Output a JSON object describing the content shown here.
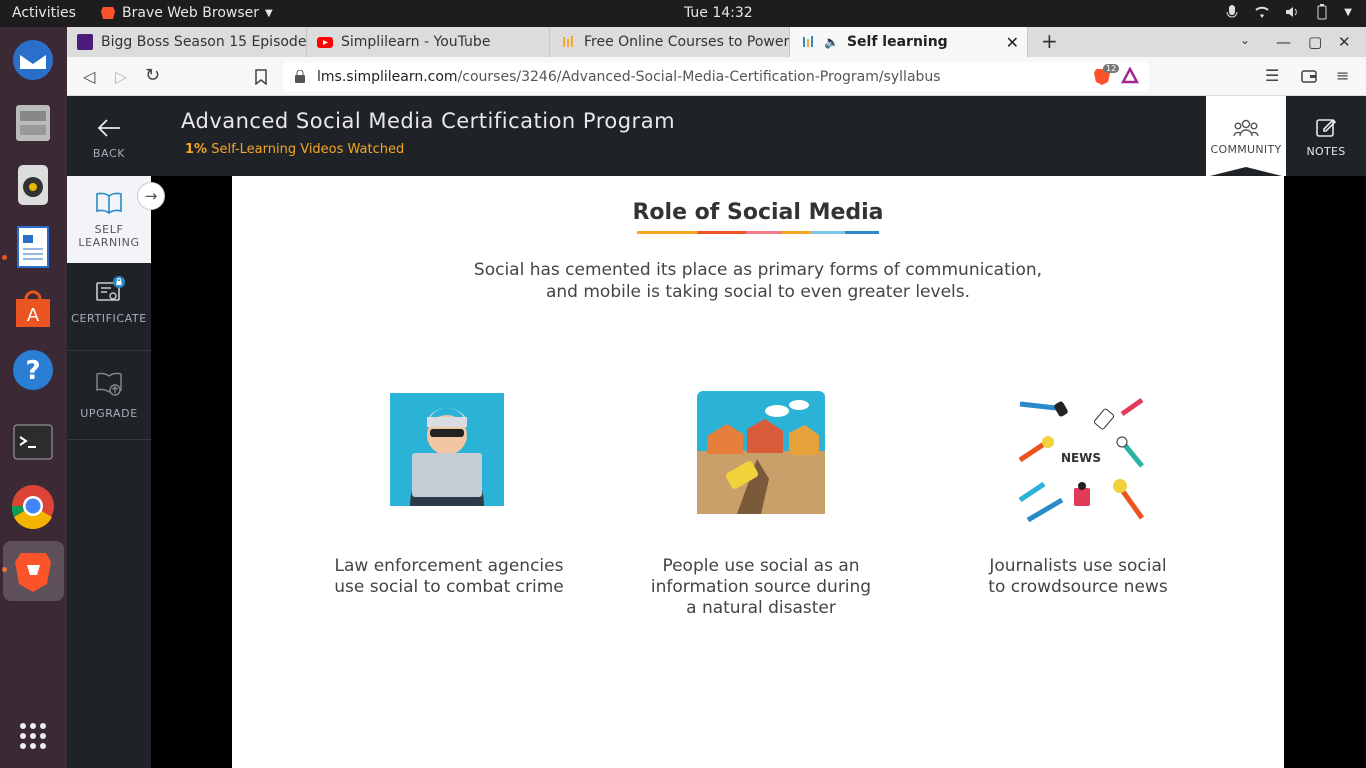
{
  "topbar": {
    "activities": "Activities",
    "app_name": "Brave Web Browser",
    "clock": "Tue 14:32"
  },
  "dock": {
    "apps": [
      "Thunderbird Mail",
      "Files",
      "Rhythmbox",
      "LibreOffice Writer",
      "Ubuntu Software",
      "Help",
      "Terminal",
      "Google Chrome",
      "Brave Web Browser",
      "Show Applications"
    ]
  },
  "browser": {
    "tabs": [
      {
        "label": "Bigg Boss Season 15 Episode",
        "favicon": "voot-icon"
      },
      {
        "label": "Simplilearn - YouTube",
        "favicon": "youtube-icon"
      },
      {
        "label": "Free Online Courses to Power",
        "favicon": "simplilearn-icon"
      },
      {
        "label": "Self learning",
        "favicon": "simplilearn-icon"
      }
    ],
    "url_host": "lms.simplilearn.com",
    "url_path": "/courses/3246/Advanced-Social-Media-Certification-Program/syllabus",
    "shield_count": "12"
  },
  "header": {
    "title": "Advanced Social Media Certification Program",
    "progress_value": "1%",
    "progress_label": "Self-Learning Videos Watched",
    "community_label": "COMMUNITY",
    "notes_label": "NOTES"
  },
  "sidebar": {
    "back_label": "BACK",
    "self_label_1": "SELF",
    "self_label_2": "LEARNING",
    "certificate_label": "CERTIFICATE",
    "upgrade_label": "UPGRADE"
  },
  "slide": {
    "title": "Role of Social Media",
    "subtitle_1": "Social has cemented its place as primary forms of communication,",
    "subtitle_2": "and mobile is taking social to even greater levels.",
    "cards": [
      {
        "line1": "Law enforcement agencies",
        "line2": "use social to combat crime",
        "line3": ""
      },
      {
        "line1": "People use social as an",
        "line2": "information source during",
        "line3": "a natural disaster"
      },
      {
        "line1": "Journalists use social",
        "line2": "to crowdsource news",
        "line3": ""
      }
    ],
    "news_badge": "NEWS"
  },
  "colors": {
    "accent": "#f5a623",
    "header_bg": "#1f2226",
    "brave_orange": "#fb542b"
  }
}
